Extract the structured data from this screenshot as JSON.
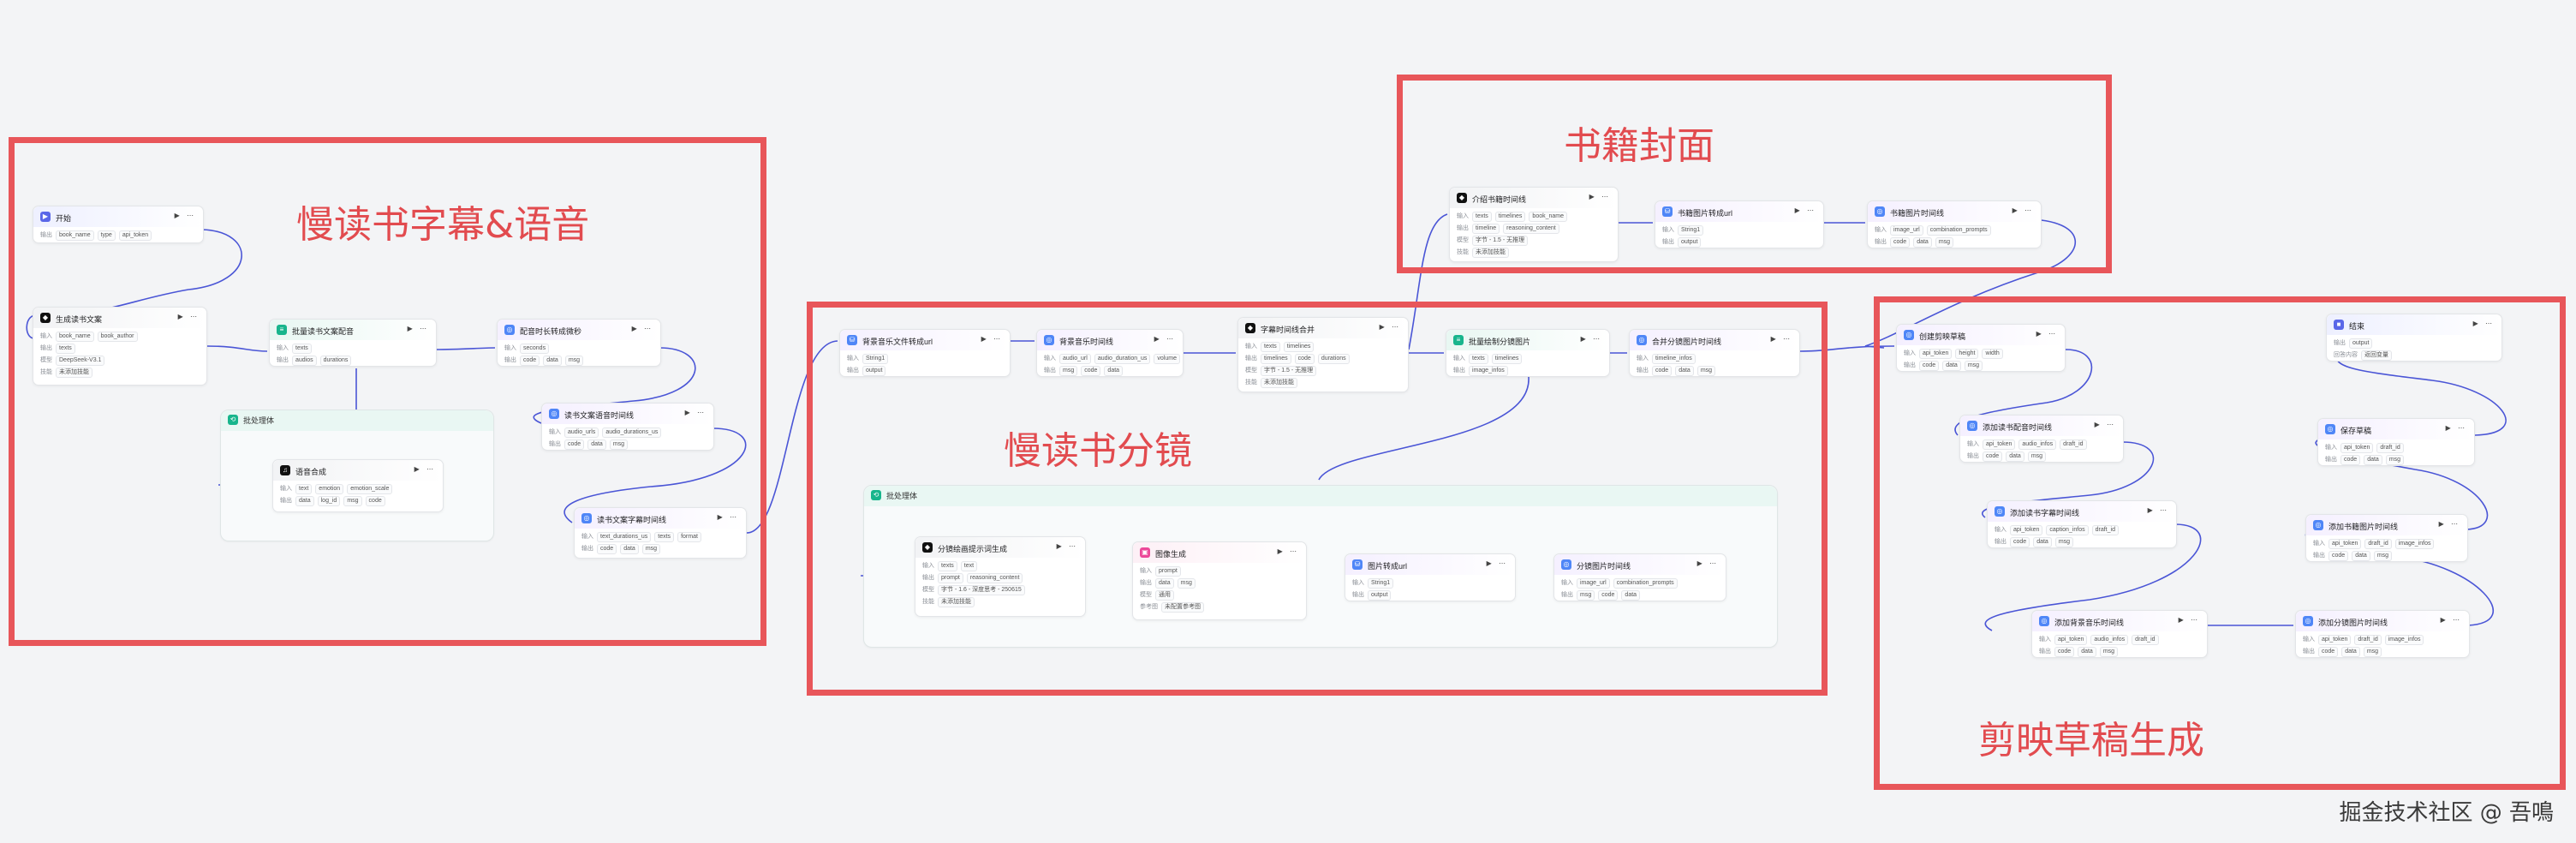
{
  "groups": {
    "subtitle_voice": "慢读书字幕&语音",
    "cover": "书籍封面",
    "storyboard": "慢读书分镜",
    "draft": "剪映草稿生成"
  },
  "watermark": "掘金技术社区 @ 吾鳴",
  "colors": {
    "group_border": "#e8565a",
    "edge": "#4a55d6",
    "icon_start": "#5a67e8",
    "icon_llm": "#111111",
    "icon_plugin": "#4f86f7",
    "icon_batch": "#18b58c",
    "icon_image": "#ec4899"
  },
  "batches": {
    "b1": "批处理体",
    "b2": "批处理体"
  },
  "nodes": {
    "start": {
      "title": "开始",
      "rows": [
        {
          "label": "输出",
          "chips": [
            "book_name",
            "type",
            "api_token"
          ]
        }
      ]
    },
    "gen_copy": {
      "title": "生成读书文案",
      "rows": [
        {
          "label": "输入",
          "chips": [
            "book_name",
            "book_author"
          ]
        },
        {
          "label": "输出",
          "chips": [
            "texts"
          ]
        },
        {
          "label": "模型",
          "chips": [
            "DeepSeek-V3.1"
          ]
        },
        {
          "label": "技能",
          "chips": [
            "未添加技能"
          ]
        }
      ]
    },
    "batch_dub": {
      "title": "批量读书文案配音",
      "rows": [
        {
          "label": "输入",
          "chips": [
            "texts"
          ]
        },
        {
          "label": "输出",
          "chips": [
            "audios",
            "durations"
          ]
        }
      ]
    },
    "dub_timeline": {
      "title": "配音时长转成微秒",
      "rows": [
        {
          "label": "输入",
          "chips": [
            "seconds"
          ]
        },
        {
          "label": "输出",
          "chips": [
            "code",
            "data",
            "msg"
          ]
        }
      ]
    },
    "tts": {
      "title": "语音合成",
      "rows": [
        {
          "label": "输入",
          "chips": [
            "text",
            "emotion",
            "emotion_scale"
          ]
        },
        {
          "label": "输出",
          "chips": [
            "data",
            "log_id",
            "msg",
            "code"
          ]
        }
      ]
    },
    "copy_audio_timeline": {
      "title": "读书文案语音时间线",
      "rows": [
        {
          "label": "输入",
          "chips": [
            "audio_urls",
            "audio_durations_us"
          ]
        },
        {
          "label": "输出",
          "chips": [
            "code",
            "data",
            "msg"
          ]
        }
      ]
    },
    "copy_caption_timeline": {
      "title": "读书文案字幕时间线",
      "rows": [
        {
          "label": "输入",
          "chips": [
            "text_durations_us",
            "texts",
            "format"
          ]
        },
        {
          "label": "输出",
          "chips": [
            "code",
            "data",
            "msg"
          ]
        }
      ]
    },
    "bgm_url": {
      "title": "背景音乐文件转成url",
      "rows": [
        {
          "label": "输入",
          "chips": [
            "String1"
          ]
        },
        {
          "label": "输出",
          "chips": [
            "output"
          ]
        }
      ]
    },
    "bgm_timeline": {
      "title": "背景音乐时间线",
      "rows": [
        {
          "label": "输入",
          "chips": [
            "audio_url",
            "audio_duration_us",
            "volume"
          ]
        },
        {
          "label": "输出",
          "chips": [
            "msg",
            "code",
            "data"
          ]
        }
      ]
    },
    "caption_merge": {
      "title": "字幕时间线合并",
      "rows": [
        {
          "label": "输入",
          "chips": [
            "texts",
            "timelines"
          ]
        },
        {
          "label": "输出",
          "chips": [
            "timelines",
            "code",
            "durations"
          ]
        },
        {
          "label": "模型",
          "chips": [
            "字节 - 1.5 - 无推理"
          ]
        },
        {
          "label": "技能",
          "chips": [
            "未添加技能"
          ]
        }
      ]
    },
    "batch_draw": {
      "title": "批量绘制分镜图片",
      "rows": [
        {
          "label": "输入",
          "chips": [
            "texts",
            "timelines"
          ]
        },
        {
          "label": "输出",
          "chips": [
            "image_infos"
          ]
        }
      ]
    },
    "merge_img_timeline": {
      "title": "合并分镜图片时间线",
      "rows": [
        {
          "label": "输入",
          "chips": [
            "timeline_infos"
          ]
        },
        {
          "label": "输出",
          "chips": [
            "code",
            "data",
            "msg"
          ]
        }
      ]
    },
    "story_prompt": {
      "title": "分镜绘画提示词生成",
      "rows": [
        {
          "label": "输入",
          "chips": [
            "texts",
            "text"
          ]
        },
        {
          "label": "输出",
          "chips": [
            "prompt",
            "reasoning_content"
          ]
        },
        {
          "label": "模型",
          "chips": [
            "字节 - 1.6 - 深度思考 - 250615"
          ]
        },
        {
          "label": "技能",
          "chips": [
            "未添加技能"
          ]
        }
      ]
    },
    "img_gen": {
      "title": "图像生成",
      "rows": [
        {
          "label": "输入",
          "chips": [
            "prompt"
          ]
        },
        {
          "label": "输出",
          "chips": [
            "data",
            "msg"
          ]
        },
        {
          "label": "模型",
          "chips": [
            "通用"
          ]
        },
        {
          "label": "参考图",
          "chips": [
            "未配置参考图"
          ]
        }
      ]
    },
    "img_url": {
      "title": "图片转成url",
      "rows": [
        {
          "label": "输入",
          "chips": [
            "String1"
          ]
        },
        {
          "label": "输出",
          "chips": [
            "output"
          ]
        }
      ]
    },
    "story_img_timeline": {
      "title": "分镜图片时间线",
      "rows": [
        {
          "label": "输入",
          "chips": [
            "image_url",
            "combination_prompts"
          ]
        },
        {
          "label": "输出",
          "chips": [
            "msg",
            "code",
            "data"
          ]
        }
      ]
    },
    "cover_timeline": {
      "title": "介绍书籍时间线",
      "rows": [
        {
          "label": "输入",
          "chips": [
            "texts",
            "timelines",
            "book_name"
          ]
        },
        {
          "label": "输出",
          "chips": [
            "timeline",
            "reasoning_content"
          ]
        },
        {
          "label": "模型",
          "chips": [
            "字节 - 1.5 - 无推理"
          ]
        },
        {
          "label": "技能",
          "chips": [
            "未添加技能"
          ]
        }
      ]
    },
    "cover_img_url": {
      "title": "书籍图片转成url",
      "rows": [
        {
          "label": "输入",
          "chips": [
            "String1"
          ]
        },
        {
          "label": "输出",
          "chips": [
            "output"
          ]
        }
      ]
    },
    "cover_img_timeline": {
      "title": "书籍图片时间线",
      "rows": [
        {
          "label": "输入",
          "chips": [
            "image_url",
            "combination_prompts"
          ]
        },
        {
          "label": "输出",
          "chips": [
            "code",
            "data",
            "msg"
          ]
        }
      ]
    },
    "create_draft": {
      "title": "创建剪映草稿",
      "rows": [
        {
          "label": "输入",
          "chips": [
            "api_token",
            "height",
            "width"
          ]
        },
        {
          "label": "输出",
          "chips": [
            "code",
            "data",
            "msg"
          ]
        }
      ]
    },
    "add_dub": {
      "title": "添加读书配音时间线",
      "rows": [
        {
          "label": "输入",
          "chips": [
            "api_token",
            "audio_infos",
            "draft_id"
          ]
        },
        {
          "label": "输出",
          "chips": [
            "code",
            "data",
            "msg"
          ]
        }
      ]
    },
    "add_caption": {
      "title": "添加读书字幕时间线",
      "rows": [
        {
          "label": "输入",
          "chips": [
            "api_token",
            "caption_infos",
            "draft_id"
          ]
        },
        {
          "label": "输出",
          "chips": [
            "code",
            "data",
            "msg"
          ]
        }
      ]
    },
    "add_bgm": {
      "title": "添加背景音乐时间线",
      "rows": [
        {
          "label": "输入",
          "chips": [
            "api_token",
            "audio_infos",
            "draft_id"
          ]
        },
        {
          "label": "输出",
          "chips": [
            "code",
            "data",
            "msg"
          ]
        }
      ]
    },
    "add_story_img": {
      "title": "添加分镜图片时间线",
      "rows": [
        {
          "label": "输入",
          "chips": [
            "api_token",
            "draft_id",
            "image_infos"
          ]
        },
        {
          "label": "输出",
          "chips": [
            "code",
            "data",
            "msg"
          ]
        }
      ]
    },
    "add_cover": {
      "title": "添加书籍图片时间线",
      "rows": [
        {
          "label": "输入",
          "chips": [
            "api_token",
            "draft_id",
            "image_infos"
          ]
        },
        {
          "label": "输出",
          "chips": [
            "code",
            "data",
            "msg"
          ]
        }
      ]
    },
    "save_draft": {
      "title": "保存草稿",
      "rows": [
        {
          "label": "输入",
          "chips": [
            "api_token",
            "draft_id"
          ]
        },
        {
          "label": "输出",
          "chips": [
            "code",
            "data",
            "msg"
          ]
        }
      ]
    },
    "end": {
      "title": "结束",
      "rows": [
        {
          "label": "输出",
          "chips": [
            "output"
          ]
        },
        {
          "label": "回答内容",
          "chips": [
            "返回变量"
          ]
        }
      ]
    }
  }
}
